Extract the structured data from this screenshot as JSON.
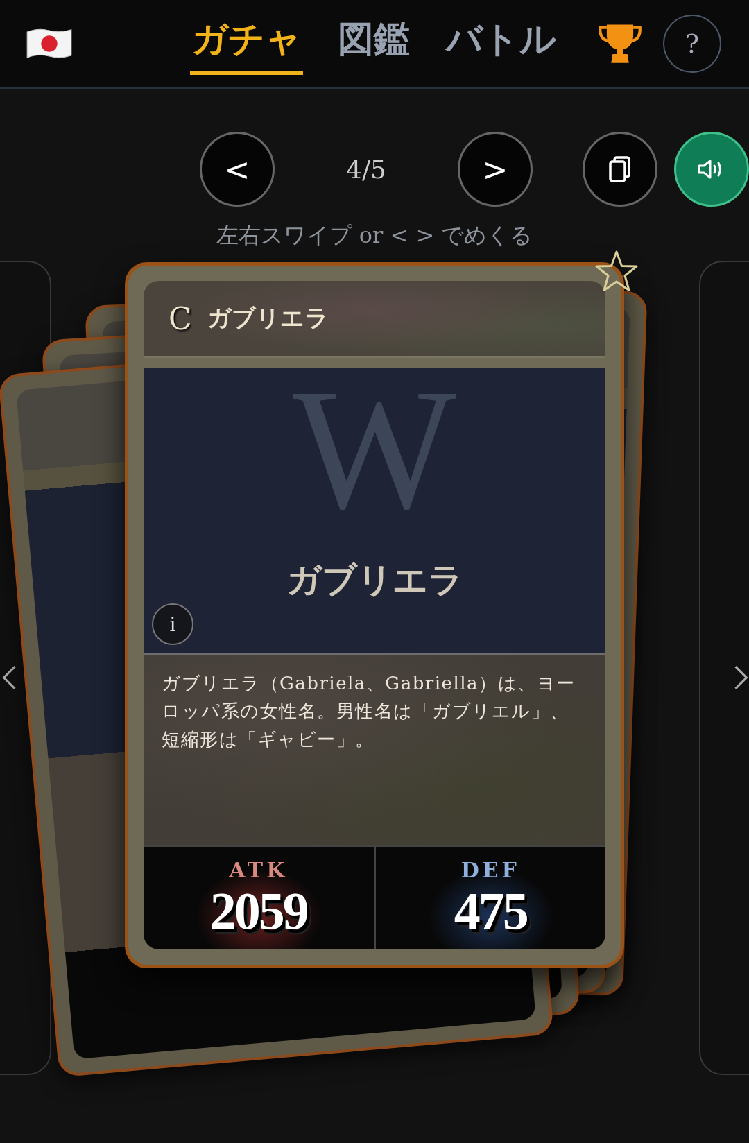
{
  "top_bar": {
    "tabs": [
      {
        "label": "ガチャ",
        "selected": true
      },
      {
        "label": "図鑑",
        "selected": false
      },
      {
        "label": "バトル",
        "selected": false
      }
    ],
    "help": "?"
  },
  "pager": {
    "prev": "<",
    "counter": "4/5",
    "next": ">",
    "sound_on": true,
    "hint": "左右スワイプ or < > でめくる"
  },
  "card": {
    "rarity": "C",
    "name": "ガブリエラ",
    "favorite": false,
    "art_letter": "W",
    "art_title": "ガブリエラ",
    "info": "i",
    "description": "ガブリエラ（Gabriela、Gabriella）は、ヨーロッパ系の女性名。男性名は「ガブリエル」、短縮形は「ギャビー」。",
    "stats": [
      {
        "kind": "attack",
        "label": "ATK",
        "value": "2059"
      },
      {
        "kind": "defense",
        "label": "DEF",
        "value": "475"
      }
    ]
  }
}
